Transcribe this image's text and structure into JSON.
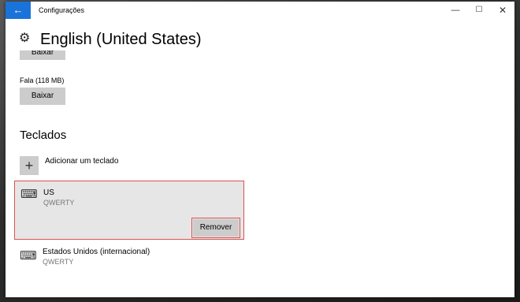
{
  "window": {
    "title": "Configurações",
    "back_glyph": "←",
    "controls": {
      "minimize": "—",
      "maximize": "☐",
      "close": "✕"
    }
  },
  "page": {
    "title": "English (United States)",
    "icon": "gear-icon"
  },
  "downloads": {
    "top_button": "Baixar",
    "speech_label": "Fala (118 MB)",
    "speech_button": "Baixar"
  },
  "keyboards": {
    "section_title": "Teclados",
    "add_label": "Adicionar um teclado",
    "items": [
      {
        "name": "US",
        "layout": "QWERTY",
        "action": "Remover"
      },
      {
        "name": "Estados Unidos (internacional)",
        "layout": "QWERTY"
      }
    ]
  },
  "colors": {
    "accent": "#1a73d9",
    "highlight_border": "#d9534f",
    "button_gray": "#cccccc",
    "selected_bg": "#e6e6e6"
  }
}
